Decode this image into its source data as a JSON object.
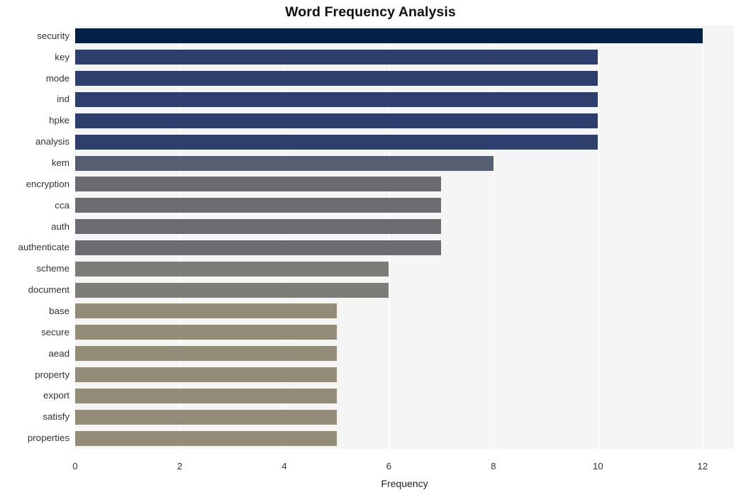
{
  "chart_data": {
    "type": "bar",
    "orientation": "horizontal",
    "title": "Word Frequency Analysis",
    "xlabel": "Frequency",
    "ylabel": "",
    "categories": [
      "security",
      "key",
      "mode",
      "ind",
      "hpke",
      "analysis",
      "kem",
      "encryption",
      "cca",
      "auth",
      "authenticate",
      "scheme",
      "document",
      "base",
      "secure",
      "aead",
      "property",
      "export",
      "satisfy",
      "properties"
    ],
    "values": [
      12,
      10,
      10,
      10,
      10,
      10,
      8,
      7,
      7,
      7,
      7,
      6,
      6,
      5,
      5,
      5,
      5,
      5,
      5,
      5
    ],
    "bar_colors": [
      "#04214a",
      "#2e3f6e",
      "#2e3f6e",
      "#2e3f6e",
      "#2e3f6e",
      "#2e3f6e",
      "#565e72",
      "#6a6c71",
      "#6a6c71",
      "#6a6c71",
      "#6a6c71",
      "#7d7c77",
      "#7d7c77",
      "#938c78",
      "#938c78",
      "#938c78",
      "#938c78",
      "#938c78",
      "#938c78",
      "#938c78"
    ],
    "xlim": [
      0,
      12.6
    ],
    "xticks": [
      0,
      2,
      4,
      6,
      8,
      10,
      12
    ],
    "xtick_labels": [
      "0",
      "2",
      "4",
      "6",
      "8",
      "10",
      "12"
    ],
    "grid": "vertical-only",
    "gridline_color": "#ffffff",
    "plot_background": "#f5f5f6",
    "figure_background": "#ffffff",
    "legend": "none"
  }
}
